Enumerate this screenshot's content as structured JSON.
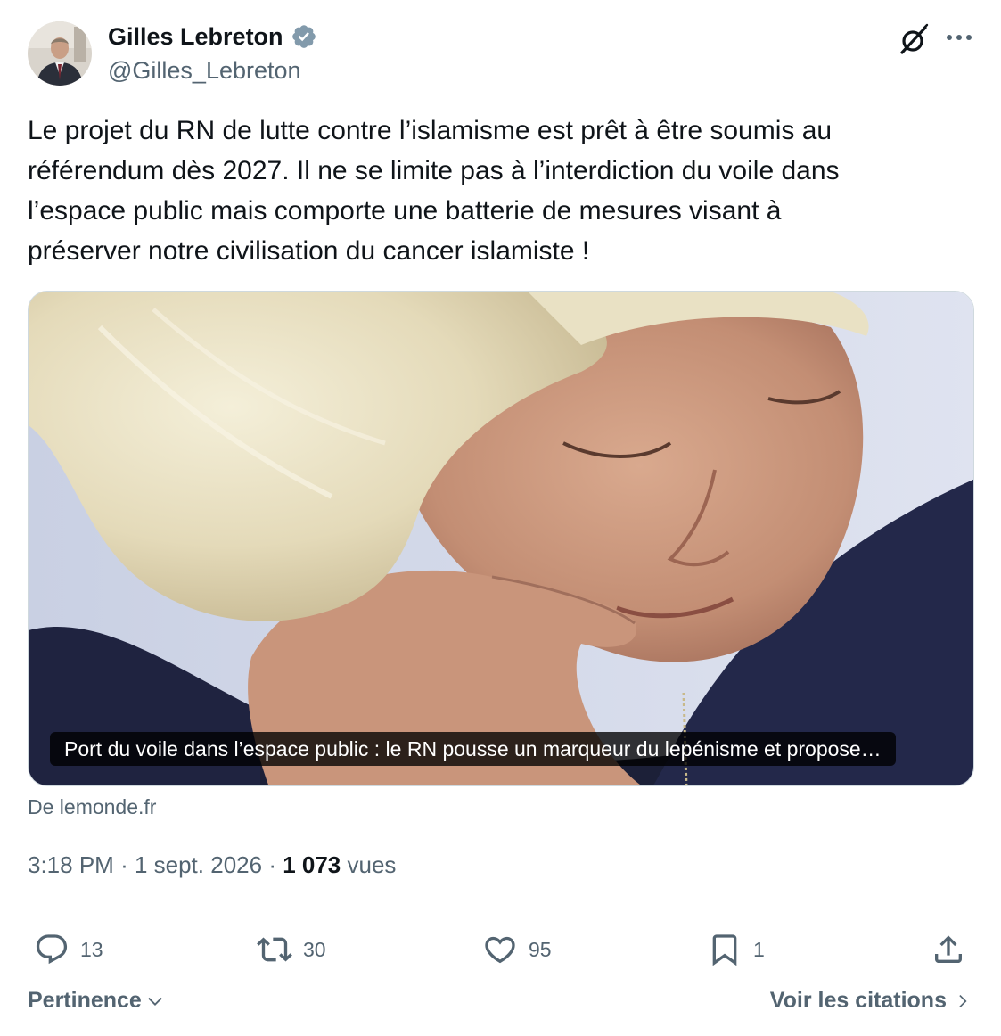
{
  "author": {
    "display_name": "Gilles Lebreton",
    "handle": "@Gilles_Lebreton",
    "verified_color": "#829aab"
  },
  "icons": {
    "grok": "grok-icon",
    "more": "more-icon",
    "reply": "reply-icon",
    "retweet": "retweet-icon",
    "like": "like-icon",
    "bookmark": "bookmark-icon",
    "share": "share-icon"
  },
  "tweet": {
    "lines": [
      "Le projet du RN de lutte contre l’islamisme est prêt à être soumis au",
      "référendum dès 2027. Il ne se limite pas à l’interdiction du voile dans",
      "l’espace public mais comporte une batterie de mesures visant à",
      "préserver notre civilisation du cancer islamiste !"
    ]
  },
  "card": {
    "caption": "Port du voile dans l’espace public : le RN pousse un marqueur du lepénisme et propose…",
    "source": "De lemonde.fr"
  },
  "meta": {
    "time": "3:18 PM",
    "date": "1 sept. 2026",
    "views_count": "1 073",
    "views_label": "vues"
  },
  "actions": {
    "replies": "13",
    "retweets": "30",
    "likes": "95",
    "bookmarks": "1"
  },
  "footer": {
    "sort_label": "Pertinence",
    "quotes_label": "Voir les citations"
  },
  "colors": {
    "text": "#0f1419",
    "secondary": "#536471",
    "divider": "#eff3f4"
  }
}
